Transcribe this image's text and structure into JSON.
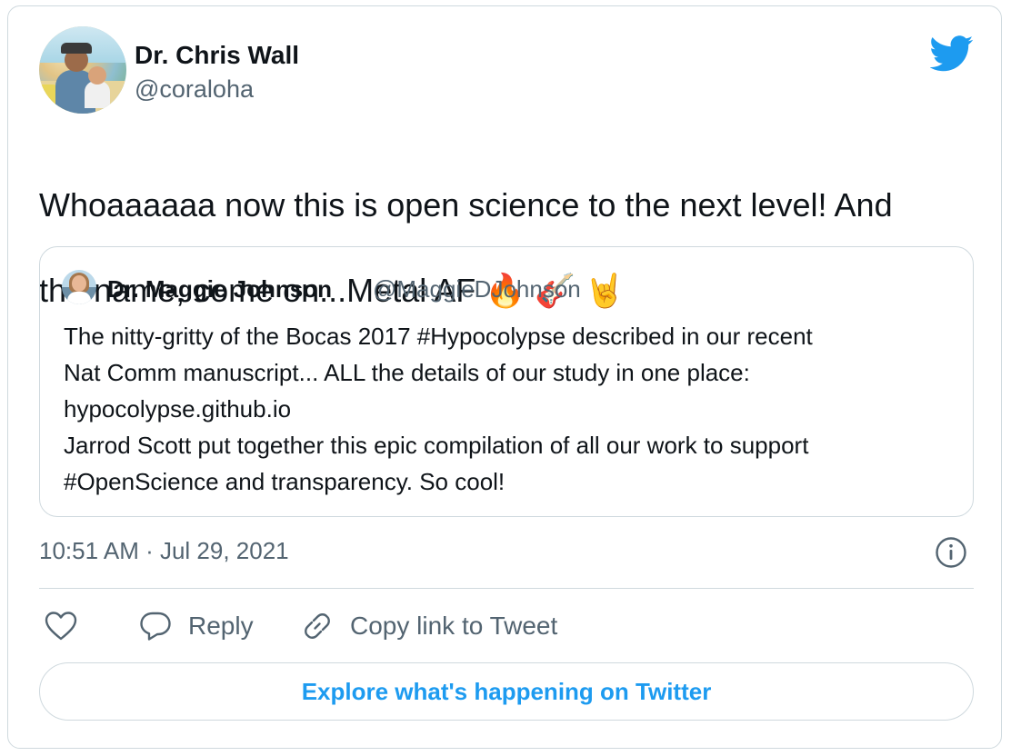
{
  "author": {
    "name": "Dr. Chris Wall",
    "handle": "@coraloha"
  },
  "tweet": {
    "line1": "Whoaaaaaa now this is open science to the next level! And",
    "line2": "the name, come on...Metal AF",
    "emojis": [
      "🔥",
      "🎸",
      "🤘"
    ]
  },
  "quoted_tweet": {
    "name": "Dr. Maggie Johnson",
    "handle": "@MaggieDJohnson",
    "lines": [
      "The nitty-gritty of the Bocas 2017 #Hypocolypse described in our recent",
      "Nat Comm manuscript... ALL the details of our study in one place:",
      "hypocolypse.github.io",
      "Jarrod Scott put together this epic compilation of all our work to support",
      "#OpenScience and transparency. So cool!"
    ]
  },
  "timestamp": "10:51 AM · Jul 29, 2021",
  "actions": {
    "reply_label": "Reply",
    "copy_label": "Copy link to Tweet"
  },
  "explore_label": "Explore what's happening on Twitter",
  "icons": {
    "brand": "twitter-bird-icon",
    "like": "heart-icon",
    "reply": "speech-bubble-icon",
    "copy": "link-icon",
    "info": "info-icon"
  },
  "colors": {
    "brand_blue": "#1d9bf0",
    "text_primary": "#0f1419",
    "text_secondary": "#536471",
    "border": "#cfd9de"
  }
}
